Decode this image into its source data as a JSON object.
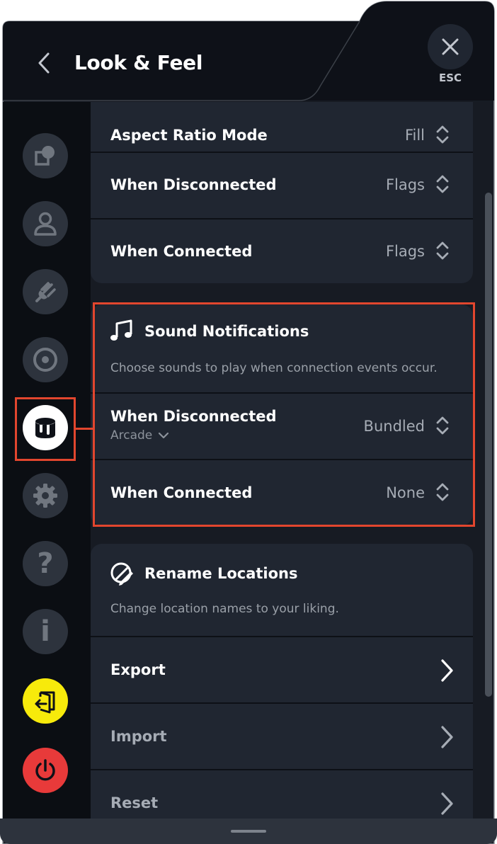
{
  "header": {
    "title": "Look & Feel",
    "esc_label": "ESC"
  },
  "sidebar": {
    "items": [
      {
        "name": "shapes-icon"
      },
      {
        "name": "person-icon"
      },
      {
        "name": "plug-icon"
      },
      {
        "name": "circle-logo-icon"
      },
      {
        "name": "paint-bucket-icon",
        "active": true
      },
      {
        "name": "gear-icon",
        "glyph": "⚙"
      },
      {
        "name": "question-icon",
        "glyph": "?"
      },
      {
        "name": "info-icon",
        "glyph": "i"
      },
      {
        "name": "switch-account-icon",
        "color": "#f7ea0b"
      },
      {
        "name": "power-icon",
        "color": "#e83a3a"
      }
    ]
  },
  "display_settings": {
    "aspect_ratio": {
      "label": "Aspect Ratio Mode",
      "value": "Fill"
    },
    "when_disconnected": {
      "label": "When Disconnected",
      "value": "Flags"
    },
    "when_connected": {
      "label": "When Connected",
      "value": "Flags"
    }
  },
  "sound_notifications": {
    "title": "Sound Notifications",
    "description": "Choose sounds to play when connection events occur.",
    "when_disconnected": {
      "label": "When Disconnected",
      "sub_value": "Arcade",
      "value": "Bundled"
    },
    "when_connected": {
      "label": "When Connected",
      "value": "None"
    }
  },
  "rename_locations": {
    "title": "Rename Locations",
    "description": "Change location names to your liking.",
    "export_label": "Export",
    "import_label": "Import",
    "reset_label": "Reset"
  },
  "colors": {
    "background": "#171b23",
    "card": "#202631",
    "highlight": "#e2462e",
    "yellow": "#f7ea0b",
    "red": "#e83a3a"
  }
}
